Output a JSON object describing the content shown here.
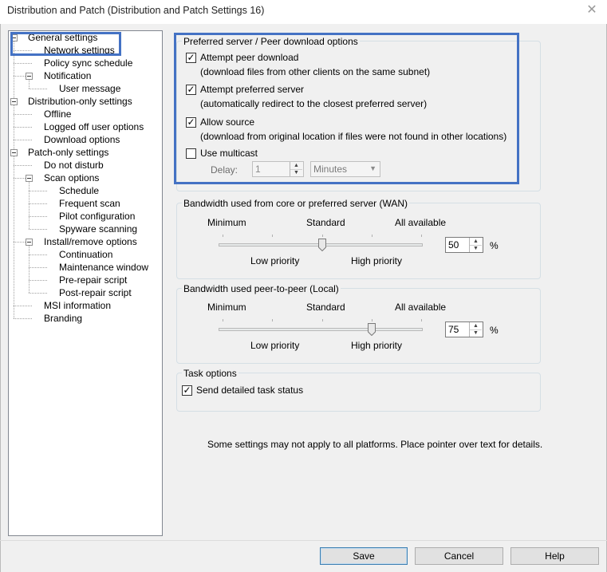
{
  "window": {
    "title": "Distribution and Patch (Distribution and Patch Settings 16)",
    "close_glyph": "✕"
  },
  "tree": [
    {
      "label": "General settings",
      "level": 0,
      "expandable": true
    },
    {
      "label": "Network settings",
      "level": 1,
      "expandable": false,
      "selected": true
    },
    {
      "label": "Policy sync schedule",
      "level": 1,
      "expandable": false
    },
    {
      "label": "Notification",
      "level": 1,
      "expandable": true
    },
    {
      "label": "User message",
      "level": 2,
      "expandable": false
    },
    {
      "label": "Distribution-only settings",
      "level": 0,
      "expandable": true
    },
    {
      "label": "Offline",
      "level": 1,
      "expandable": false
    },
    {
      "label": "Logged off user options",
      "level": 1,
      "expandable": false
    },
    {
      "label": "Download options",
      "level": 1,
      "expandable": false
    },
    {
      "label": "Patch-only settings",
      "level": 0,
      "expandable": true
    },
    {
      "label": "Do not disturb",
      "level": 1,
      "expandable": false
    },
    {
      "label": "Scan options",
      "level": 1,
      "expandable": true
    },
    {
      "label": "Schedule",
      "level": 2,
      "expandable": false
    },
    {
      "label": "Frequent scan",
      "level": 2,
      "expandable": false
    },
    {
      "label": "Pilot configuration",
      "level": 2,
      "expandable": false
    },
    {
      "label": "Spyware scanning",
      "level": 2,
      "expandable": false
    },
    {
      "label": "Install/remove options",
      "level": 1,
      "expandable": true
    },
    {
      "label": "Continuation",
      "level": 2,
      "expandable": false
    },
    {
      "label": "Maintenance window",
      "level": 2,
      "expandable": false
    },
    {
      "label": "Pre-repair script",
      "level": 2,
      "expandable": false
    },
    {
      "label": "Post-repair script",
      "level": 2,
      "expandable": false
    },
    {
      "label": "MSI information",
      "level": 1,
      "expandable": false
    },
    {
      "label": "Branding",
      "level": 1,
      "expandable": false
    }
  ],
  "peer": {
    "title": "Preferred server / Peer download options",
    "attempt_peer": {
      "label": "Attempt peer download",
      "desc": "(download files from other clients on the same subnet)",
      "checked": true
    },
    "attempt_preferred": {
      "label": "Attempt preferred server",
      "desc": "(automatically redirect to the closest preferred server)",
      "checked": true
    },
    "allow_source": {
      "label": "Allow source",
      "desc": "(download from original location if files were not found in other locations)",
      "checked": true
    },
    "multicast": {
      "label": "Use multicast",
      "checked": false
    },
    "delay_label": "Delay:",
    "delay_value": "1",
    "delay_unit": "Minutes"
  },
  "wan": {
    "title": "Bandwidth used from core or preferred server (WAN)",
    "min": "Minimum",
    "std": "Standard",
    "max": "All available",
    "low": "Low priority",
    "high": "High priority",
    "value": "50",
    "unit": "%",
    "level_percent": 50
  },
  "local": {
    "title": "Bandwidth used peer-to-peer (Local)",
    "min": "Minimum",
    "std": "Standard",
    "max": "All available",
    "low": "Low priority",
    "high": "High priority",
    "value": "75",
    "unit": "%",
    "level_percent": 75
  },
  "task": {
    "title": "Task options",
    "send_status": {
      "label": "Send detailed task status",
      "checked": true
    }
  },
  "note": "Some settings may not apply to all platforms.  Place pointer over text for details.",
  "buttons": {
    "save": "Save",
    "cancel": "Cancel",
    "help": "Help"
  },
  "colors": {
    "highlight": "#4472c4",
    "frame": "#f0f0f0"
  }
}
